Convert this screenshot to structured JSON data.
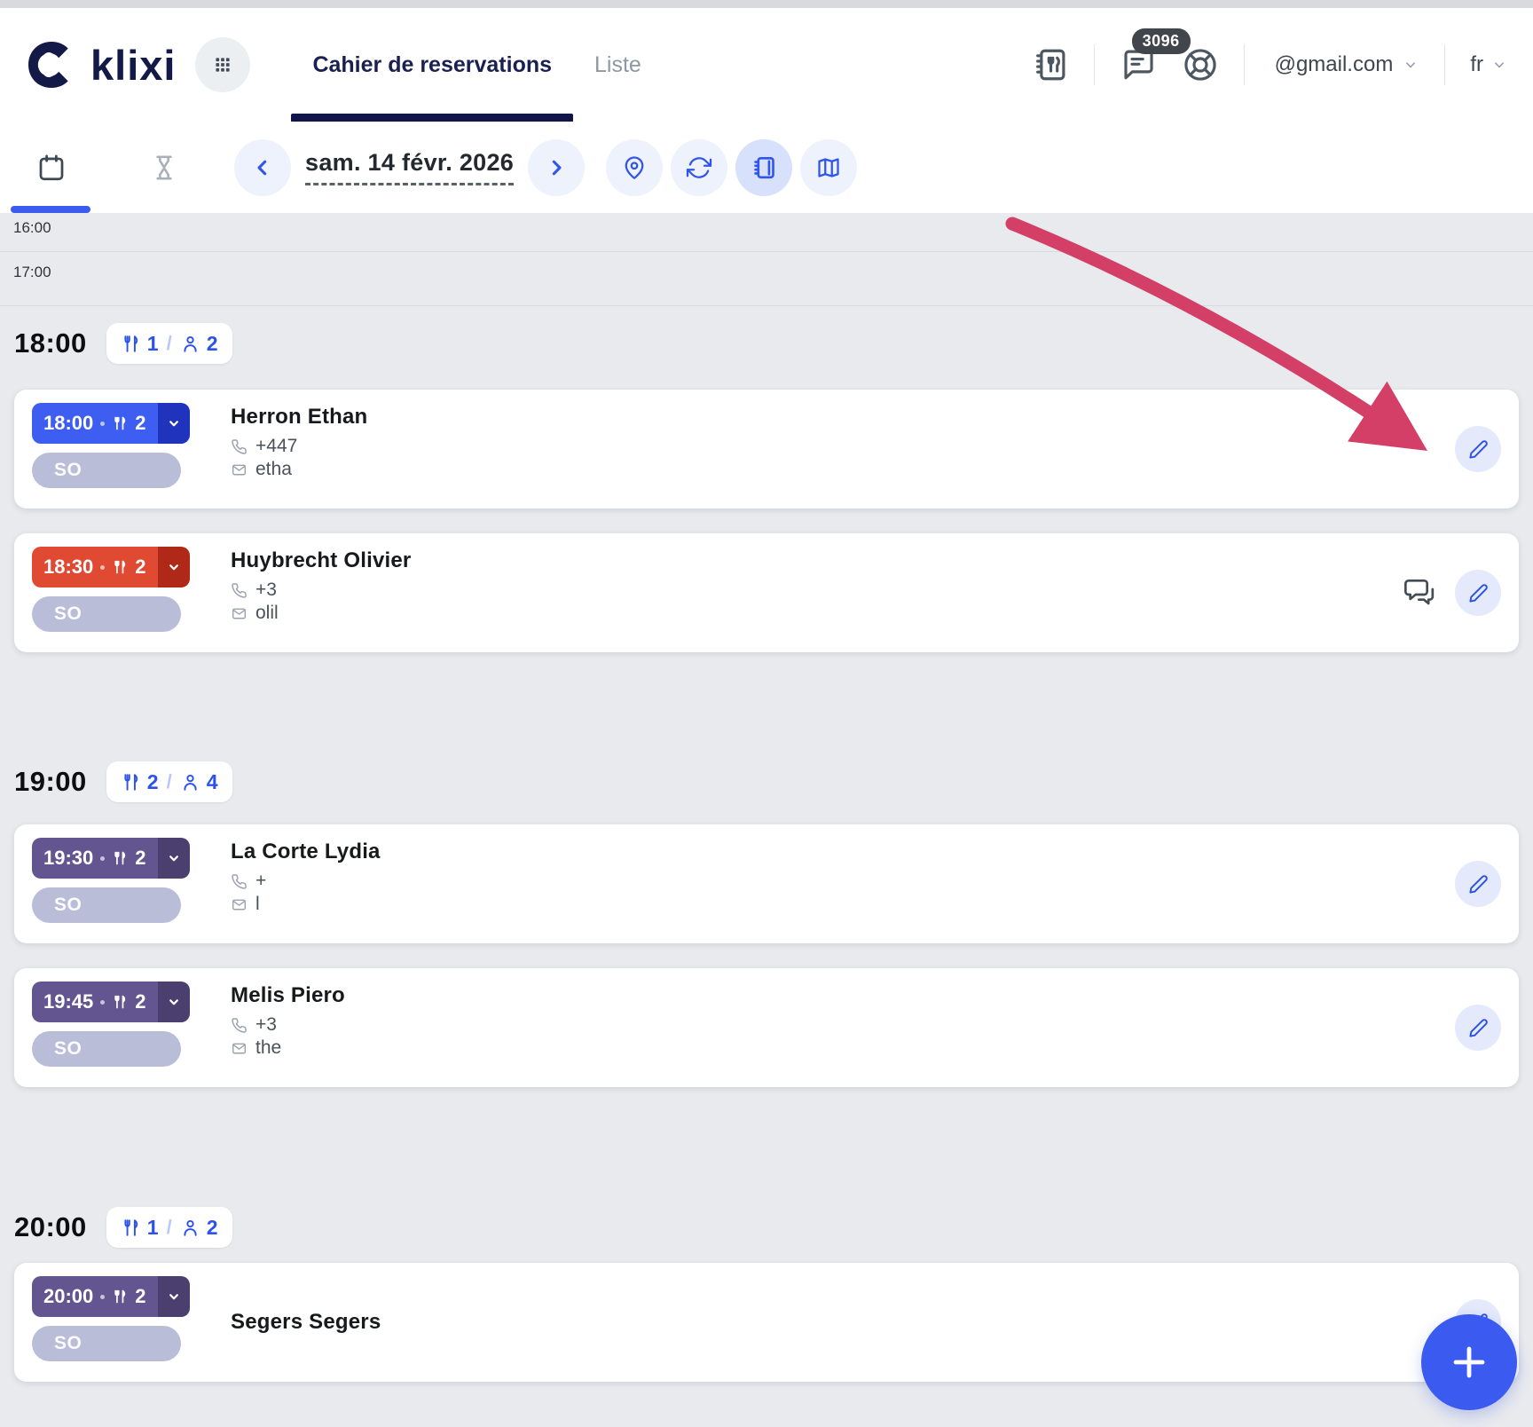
{
  "header": {
    "logo": "klixi",
    "tabs": [
      {
        "label": "Cahier de reservations"
      },
      {
        "label": "Liste"
      }
    ],
    "chat_badge": "3096",
    "account": "@gmail.com",
    "language": "fr"
  },
  "toolbar": {
    "date": "sam. 14 févr. 2026"
  },
  "timeline": {
    "sep": "/",
    "hours": [
      "16:00",
      "17:00"
    ],
    "sections": [
      {
        "hour": "18:00",
        "tables": "1",
        "guests": "2",
        "reservations": [
          {
            "time": "18:00",
            "covers": "2",
            "status": "SO",
            "name": "Herron Ethan",
            "phone": "+447",
            "email": "etha"
          },
          {
            "time": "18:30",
            "covers": "2",
            "status": "SO",
            "name": "Huybrecht Olivier",
            "phone": "+3",
            "email": "olil"
          }
        ]
      },
      {
        "hour": "19:00",
        "tables": "2",
        "guests": "4",
        "reservations": [
          {
            "time": "19:30",
            "covers": "2",
            "status": "SO",
            "name": "La Corte Lydia",
            "phone": "+",
            "email": "l"
          },
          {
            "time": "19:45",
            "covers": "2",
            "status": "SO",
            "name": "Melis Piero",
            "phone": "+3",
            "email": "the"
          }
        ]
      },
      {
        "hour": "20:00",
        "tables": "1",
        "guests": "2",
        "reservations": [
          {
            "time": "20:00",
            "covers": "2",
            "status": "SO",
            "name": "Segers Segers"
          }
        ]
      }
    ]
  },
  "fab": {
    "label": "+"
  },
  "colors": {
    "accent_blue": "#3b5bf0",
    "badge_blue": "#3e5ef2",
    "badge_red": "#e04a33",
    "badge_purple": "#635690",
    "status_pill": "#b9bdd8",
    "annotation_arrow": "#d43f68",
    "navy": "#141a48",
    "page_background": "#e8eaee"
  }
}
